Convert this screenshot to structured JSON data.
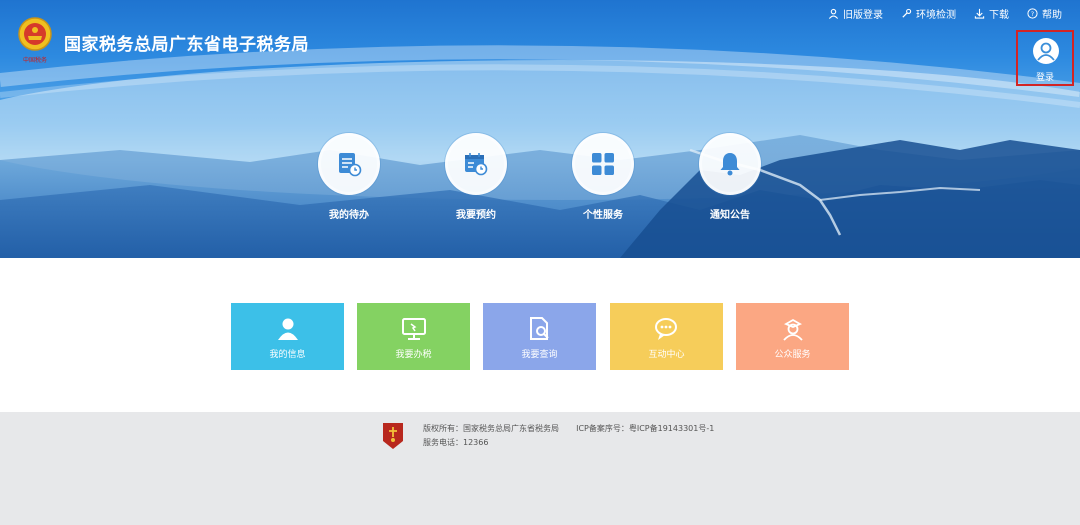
{
  "header": {
    "site_title": "国家税务总局广东省电子税务局",
    "logo_icon": "tax-emblem-icon",
    "top_nav": [
      {
        "label": "旧版登录",
        "icon": "user-icon"
      },
      {
        "label": "环境检测",
        "icon": "wrench-icon"
      },
      {
        "label": "下载",
        "icon": "download-icon"
      },
      {
        "label": "帮助",
        "icon": "help-icon"
      }
    ],
    "login": {
      "label": "登录",
      "icon": "avatar-icon",
      "highlight_color": "#d32424"
    }
  },
  "hero_nav": [
    {
      "label": "我的待办",
      "icon": "todo-clock-icon"
    },
    {
      "label": "我要预约",
      "icon": "calendar-clock-icon"
    },
    {
      "label": "个性服务",
      "icon": "grid-icon"
    },
    {
      "label": "通知公告",
      "icon": "bell-icon"
    }
  ],
  "tiles": [
    {
      "label": "我的信息",
      "icon": "person-icon",
      "color": "#3cc0e8"
    },
    {
      "label": "我要办税",
      "icon": "monitor-icon",
      "color": "#84d262"
    },
    {
      "label": "我要查询",
      "icon": "search-document-icon",
      "color": "#8ba6ea"
    },
    {
      "label": "互动中心",
      "icon": "chat-icon",
      "color": "#f6cd5a"
    },
    {
      "label": "公众服务",
      "icon": "service-person-icon",
      "color": "#fba783"
    }
  ],
  "footer": {
    "copyright": "版权所有：国家税务总局广东省税务局",
    "icp": "ICP备案序号：粤ICP备19143301号-1",
    "phone": "服务电话：12366",
    "badge_icon": "government-site-badge-icon"
  }
}
